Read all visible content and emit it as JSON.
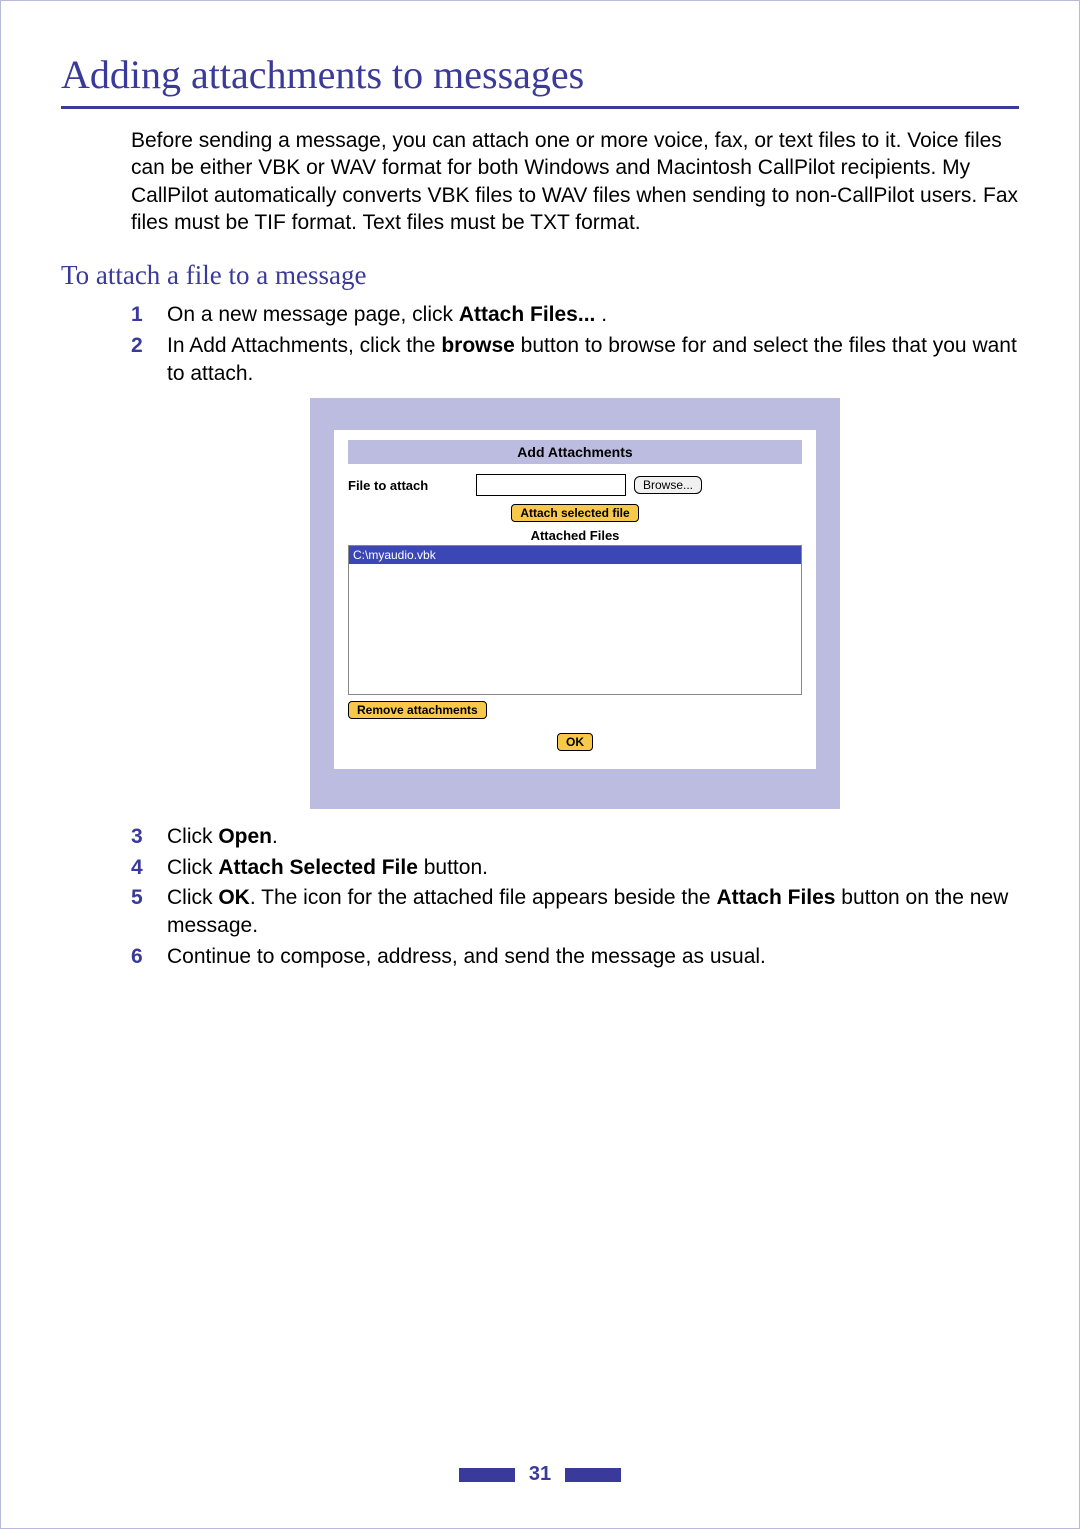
{
  "title": "Adding attachments to messages",
  "intro": "Before sending a message, you can attach one or more voice, fax, or text files to it. Voice files can be either VBK or WAV format for both Windows and Macintosh CallPilot recipients. My CallPilot automatically converts VBK files to WAV files when sending to non-CallPilot users. Fax files must be TIF format. Text files must be TXT format.",
  "subheading": "To attach a file to a message",
  "steps": {
    "s1": {
      "num": "1",
      "pre": "On a new message page, click ",
      "bold": "Attach Files...",
      "post": " ."
    },
    "s2": {
      "num": "2",
      "pre": "In Add Attachments, click the ",
      "bold": "browse",
      "post": " button to browse for and select the files that you want to attach."
    },
    "s3": {
      "num": "3",
      "pre": "Click ",
      "bold": "Open",
      "post": "."
    },
    "s4": {
      "num": "4",
      "pre": "Click ",
      "bold": "Attach Selected File",
      "post": " button."
    },
    "s5": {
      "num": "5",
      "pre": "Click ",
      "bold": "OK",
      "mid": ". The icon for the attached file appears beside the ",
      "bold2": "Attach Files",
      "post": " button on the new message."
    },
    "s6": {
      "num": "6",
      "text": "Continue to compose, address, and send the message as usual."
    }
  },
  "dialog": {
    "header": "Add Attachments",
    "file_label": "File to attach",
    "browse": "Browse...",
    "attach_btn": "Attach selected file",
    "attached_label": "Attached Files",
    "selected_file": "C:\\myaudio.vbk",
    "remove_btn": "Remove attachments",
    "ok_btn": "OK"
  },
  "page_number": "31"
}
